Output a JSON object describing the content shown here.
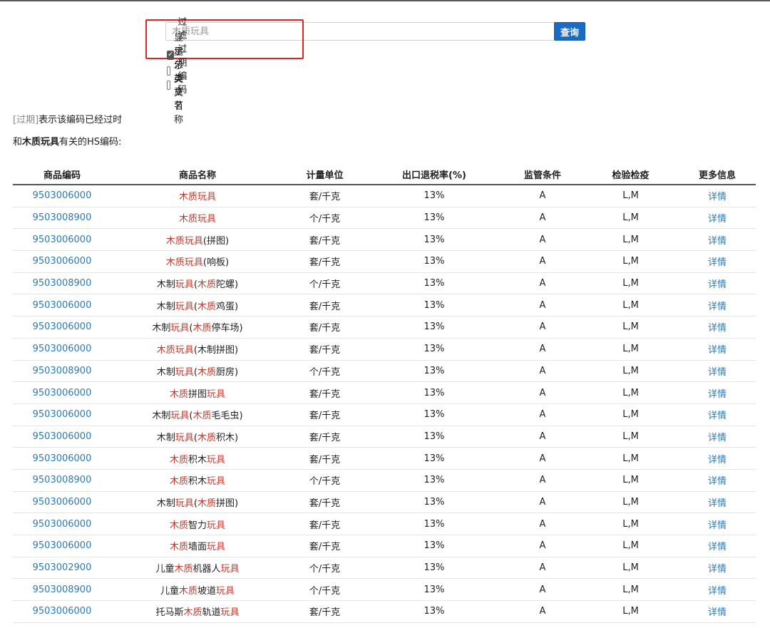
{
  "search": {
    "value": "",
    "placeholder": "木质玩具",
    "button_label": "查询"
  },
  "options": [
    {
      "label": "过滤过期编码",
      "checked": true
    },
    {
      "label": "显示分类章节",
      "checked": false
    },
    {
      "label": "显示英文名称",
      "checked": false
    }
  ],
  "note": {
    "tag": "[过期]",
    "text": "表示该编码已经过时"
  },
  "intro": {
    "prefix": "和",
    "keyword": "木质玩具",
    "suffix": "有关的HS编码:"
  },
  "table": {
    "headers": [
      "商品编码",
      "商品名称",
      "计量单位",
      "出口退税率(%)",
      "监管条件",
      "检验检疫",
      "更多信息"
    ],
    "rows": [
      {
        "code": "9503006000",
        "name": [
          {
            "t": "木质玩具",
            "h": true
          }
        ],
        "unit": "套/千克",
        "rate": "13%",
        "supervision": "A",
        "inspection": "L,M",
        "more": "详情"
      },
      {
        "code": "9503008900",
        "name": [
          {
            "t": "木质玩具",
            "h": true
          }
        ],
        "unit": "个/千克",
        "rate": "13%",
        "supervision": "A",
        "inspection": "L,M",
        "more": "详情"
      },
      {
        "code": "9503006000",
        "name": [
          {
            "t": "木质玩具",
            "h": true
          },
          {
            "t": "(拼图)",
            "h": false
          }
        ],
        "unit": "套/千克",
        "rate": "13%",
        "supervision": "A",
        "inspection": "L,M",
        "more": "详情"
      },
      {
        "code": "9503006000",
        "name": [
          {
            "t": "木质玩具",
            "h": true
          },
          {
            "t": "(响板)",
            "h": false
          }
        ],
        "unit": "套/千克",
        "rate": "13%",
        "supervision": "A",
        "inspection": "L,M",
        "more": "详情"
      },
      {
        "code": "9503008900",
        "name": [
          {
            "t": "木制",
            "h": false
          },
          {
            "t": "玩具",
            "h": true
          },
          {
            "t": "(",
            "h": false
          },
          {
            "t": "木质",
            "h": true
          },
          {
            "t": "陀螺)",
            "h": false
          }
        ],
        "unit": "个/千克",
        "rate": "13%",
        "supervision": "A",
        "inspection": "L,M",
        "more": "详情"
      },
      {
        "code": "9503006000",
        "name": [
          {
            "t": "木制",
            "h": false
          },
          {
            "t": "玩具",
            "h": true
          },
          {
            "t": "(",
            "h": false
          },
          {
            "t": "木质",
            "h": true
          },
          {
            "t": "鸡蛋)",
            "h": false
          }
        ],
        "unit": "套/千克",
        "rate": "13%",
        "supervision": "A",
        "inspection": "L,M",
        "more": "详情"
      },
      {
        "code": "9503006000",
        "name": [
          {
            "t": "木制",
            "h": false
          },
          {
            "t": "玩具",
            "h": true
          },
          {
            "t": "(",
            "h": false
          },
          {
            "t": "木质",
            "h": true
          },
          {
            "t": "停车场)",
            "h": false
          }
        ],
        "unit": "套/千克",
        "rate": "13%",
        "supervision": "A",
        "inspection": "L,M",
        "more": "详情"
      },
      {
        "code": "9503006000",
        "name": [
          {
            "t": "木质玩具",
            "h": true
          },
          {
            "t": "(木制拼图)",
            "h": false
          }
        ],
        "unit": "套/千克",
        "rate": "13%",
        "supervision": "A",
        "inspection": "L,M",
        "more": "详情"
      },
      {
        "code": "9503008900",
        "name": [
          {
            "t": "木制",
            "h": false
          },
          {
            "t": "玩具",
            "h": true
          },
          {
            "t": "(",
            "h": false
          },
          {
            "t": "木质",
            "h": true
          },
          {
            "t": "厨房)",
            "h": false
          }
        ],
        "unit": "个/千克",
        "rate": "13%",
        "supervision": "A",
        "inspection": "L,M",
        "more": "详情"
      },
      {
        "code": "9503006000",
        "name": [
          {
            "t": "木质",
            "h": true
          },
          {
            "t": "拼图",
            "h": false
          },
          {
            "t": "玩具",
            "h": true
          }
        ],
        "unit": "套/千克",
        "rate": "13%",
        "supervision": "A",
        "inspection": "L,M",
        "more": "详情"
      },
      {
        "code": "9503006000",
        "name": [
          {
            "t": "木制",
            "h": false
          },
          {
            "t": "玩具",
            "h": true
          },
          {
            "t": "(",
            "h": false
          },
          {
            "t": "木质",
            "h": true
          },
          {
            "t": "毛毛虫)",
            "h": false
          }
        ],
        "unit": "套/千克",
        "rate": "13%",
        "supervision": "A",
        "inspection": "L,M",
        "more": "详情"
      },
      {
        "code": "9503006000",
        "name": [
          {
            "t": "木制",
            "h": false
          },
          {
            "t": "玩具",
            "h": true
          },
          {
            "t": "(",
            "h": false
          },
          {
            "t": "木质",
            "h": true
          },
          {
            "t": "积木)",
            "h": false
          }
        ],
        "unit": "套/千克",
        "rate": "13%",
        "supervision": "A",
        "inspection": "L,M",
        "more": "详情"
      },
      {
        "code": "9503006000",
        "name": [
          {
            "t": "木质",
            "h": true
          },
          {
            "t": "积木",
            "h": false
          },
          {
            "t": "玩具",
            "h": true
          }
        ],
        "unit": "套/千克",
        "rate": "13%",
        "supervision": "A",
        "inspection": "L,M",
        "more": "详情"
      },
      {
        "code": "9503008900",
        "name": [
          {
            "t": "木质",
            "h": true
          },
          {
            "t": "积木",
            "h": false
          },
          {
            "t": "玩具",
            "h": true
          }
        ],
        "unit": "个/千克",
        "rate": "13%",
        "supervision": "A",
        "inspection": "L,M",
        "more": "详情"
      },
      {
        "code": "9503006000",
        "name": [
          {
            "t": "木制",
            "h": false
          },
          {
            "t": "玩具",
            "h": true
          },
          {
            "t": "(",
            "h": false
          },
          {
            "t": "木质",
            "h": true
          },
          {
            "t": "拼图)",
            "h": false
          }
        ],
        "unit": "套/千克",
        "rate": "13%",
        "supervision": "A",
        "inspection": "L,M",
        "more": "详情"
      },
      {
        "code": "9503006000",
        "name": [
          {
            "t": "木质",
            "h": true
          },
          {
            "t": "智力",
            "h": false
          },
          {
            "t": "玩具",
            "h": true
          }
        ],
        "unit": "套/千克",
        "rate": "13%",
        "supervision": "A",
        "inspection": "L,M",
        "more": "详情"
      },
      {
        "code": "9503006000",
        "name": [
          {
            "t": "木质",
            "h": true
          },
          {
            "t": "墙面",
            "h": false
          },
          {
            "t": "玩具",
            "h": true
          }
        ],
        "unit": "套/千克",
        "rate": "13%",
        "supervision": "A",
        "inspection": "L,M",
        "more": "详情"
      },
      {
        "code": "9503002900",
        "name": [
          {
            "t": "儿童",
            "h": false
          },
          {
            "t": "木质",
            "h": true
          },
          {
            "t": "机器人",
            "h": false
          },
          {
            "t": "玩具",
            "h": true
          }
        ],
        "unit": "个/千克",
        "rate": "13%",
        "supervision": "A",
        "inspection": "L,M",
        "more": "详情"
      },
      {
        "code": "9503008900",
        "name": [
          {
            "t": "儿童",
            "h": false
          },
          {
            "t": "木质",
            "h": true
          },
          {
            "t": "坡道",
            "h": false
          },
          {
            "t": "玩具",
            "h": true
          }
        ],
        "unit": "个/千克",
        "rate": "13%",
        "supervision": "A",
        "inspection": "L,M",
        "more": "详情"
      },
      {
        "code": "9503006000",
        "name": [
          {
            "t": "托马斯",
            "h": false
          },
          {
            "t": "木质",
            "h": true
          },
          {
            "t": "轨道",
            "h": false
          },
          {
            "t": "玩具",
            "h": true
          }
        ],
        "unit": "套/千克",
        "rate": "13%",
        "supervision": "A",
        "inspection": "L,M",
        "more": "详情"
      }
    ]
  }
}
